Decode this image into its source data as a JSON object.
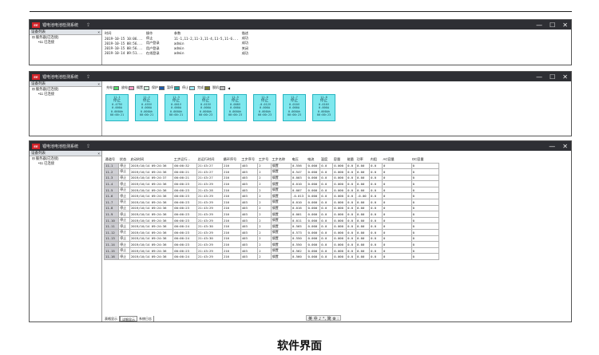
{
  "app": {
    "logo_text": "EE",
    "title": "锂电池电池检测系统",
    "pin_icon": "pin-icon",
    "min": "—",
    "max": "☐",
    "close": "✕"
  },
  "sidebar": {
    "header": "设备列表",
    "close_label": "×",
    "root": "⊟ 服务器(已连接)",
    "child": "•11 已连接"
  },
  "win1": {
    "headers": [
      "时间",
      "操作",
      "参数",
      "描述"
    ],
    "rows": [
      [
        "2019-10-15 10:06...",
        "停止",
        "11-1,11-2,11-3,11-4,11-5,11-6...",
        "成功"
      ],
      [
        "2019-10-15 08:56...",
        "用户登录",
        "admin",
        "成功"
      ],
      [
        "2019-10-15 08:56...",
        "用户登录",
        "admin",
        "关闭"
      ],
      [
        "2019-10-14 09:51...",
        "在线登录",
        "admin",
        "成功"
      ]
    ]
  },
  "win2": {
    "legend": [
      {
        "label": "充电",
        "color": "#53d96a"
      },
      {
        "label": "放电",
        "color": "#f49ac2"
      },
      {
        "label": "搁置",
        "color": "#cfeedd"
      },
      {
        "label": "保护",
        "color": "#1e5aa8"
      },
      {
        "label": "暂停",
        "color": "#2aa6a6"
      },
      {
        "label": "停止",
        "color": "#9fe8f3"
      },
      {
        "label": "完成",
        "color": "#7a7a30"
      },
      {
        "label": "脱机",
        "color": "#bdbdbd"
      }
    ],
    "legend_arrow": "◀",
    "cards": [
      {
        "id": "11-1",
        "state": "停止",
        "v": "0.479V",
        "a": "0.000A",
        "ah": "0.000Ah",
        "t": "00:00:21"
      },
      {
        "id": "11-2",
        "state": "停止",
        "v": "0.455V",
        "a": "0.000A",
        "ah": "0.000Ah",
        "t": "00:00:21"
      },
      {
        "id": "11-3",
        "state": "停止",
        "v": "0.001V",
        "a": "0.000A",
        "ah": "0.000Ah",
        "t": "00:00:21"
      },
      {
        "id": "11-4",
        "state": "停止",
        "v": "0.015V",
        "a": "0.000A",
        "ah": "0.000Ah",
        "t": "00:00:23"
      },
      {
        "id": "11-5",
        "state": "停止",
        "v": "0.008V",
        "a": "0.000A",
        "ah": "0.000Ah",
        "t": "00:00:23"
      },
      {
        "id": "11-6",
        "state": "停止",
        "v": "-0.012V",
        "a": "0.000A",
        "ah": "0.000Ah",
        "t": "00:00:23"
      },
      {
        "id": "11-7",
        "state": "停止",
        "v": "0.010V",
        "a": "0.000A",
        "ah": "0.000Ah",
        "t": "00:00:23"
      },
      {
        "id": "11-8",
        "state": "停止",
        "v": "0.016V",
        "a": "0.000A",
        "ah": "0.000Ah",
        "t": "00:00:23"
      }
    ]
  },
  "win3": {
    "headers": [
      "通道号",
      "状态",
      "启动时间",
      "工步运行...",
      "总运行时间",
      "循环序号",
      "工步序号",
      "工步号",
      "工步名称",
      "电压",
      "电流",
      "温度",
      "容量",
      "能量",
      "功率",
      "内阻",
      "AC容量",
      "DC容量"
    ],
    "rows": [
      [
        "11-1",
        "停止",
        "2019/10/14 09:24:36",
        "00:00:32",
        "21:43:27",
        "216",
        "403",
        "2",
        "搁置",
        "0.556",
        "0.000",
        "0.0",
        "0.000",
        "0.0",
        "0.00",
        "0.0",
        "0",
        "0"
      ],
      [
        "11-2",
        "停止",
        "2019/10/14 09:24:36",
        "00:00:21",
        "21:43:27",
        "216",
        "403",
        "2",
        "搁置",
        "0.547",
        "0.000",
        "0.0",
        "0.000",
        "0.0",
        "0.00",
        "0.0",
        "0",
        "0"
      ],
      [
        "11-3",
        "停止",
        "2019/10/14 09:24:37",
        "00:00:21",
        "21:43:27",
        "216",
        "403",
        "2",
        "搁置",
        "0.003",
        "0.000",
        "0.0",
        "0.000",
        "0.0",
        "0.00",
        "0.0",
        "0",
        "0"
      ],
      [
        "11-4",
        "停止",
        "2019/10/14 09:24:36",
        "00:00:23",
        "21:43:29",
        "216",
        "403",
        "2",
        "搁置",
        "0.010",
        "0.000",
        "0.0",
        "0.000",
        "0.0",
        "0.00",
        "0.0",
        "0",
        "0"
      ],
      [
        "11-5",
        "停止",
        "2019/10/14 09:24:36",
        "00:00:23",
        "21:43:28",
        "216",
        "403",
        "2",
        "搁置",
        "0.007",
        "0.000",
        "0.0",
        "0.000",
        "0.0",
        "0.00",
        "0.0",
        "0",
        "0"
      ],
      [
        "11-6",
        "停止",
        "2019/10/14 09:24:36",
        "00:00:23",
        "21:43:29",
        "216",
        "403",
        "2",
        "搁置",
        "-0.013",
        "0.000",
        "0.0",
        "0.000",
        "0.0",
        "-0.00",
        "0.0",
        "0",
        "0"
      ],
      [
        "11-7",
        "停止",
        "2019/10/14 09:24:36",
        "00:00:23",
        "21:43:29",
        "216",
        "403",
        "2",
        "搁置",
        "0.010",
        "0.000",
        "0.0",
        "0.000",
        "0.0",
        "0.00",
        "0.0",
        "0",
        "0"
      ],
      [
        "11-8",
        "停止",
        "2019/10/14 09:24:36",
        "00:00:23",
        "21:43:29",
        "216",
        "403",
        "2",
        "搁置",
        "0.016",
        "0.000",
        "0.0",
        "0.000",
        "0.0",
        "0.00",
        "0.0",
        "0",
        "0"
      ],
      [
        "11-9",
        "停止",
        "2019/10/14 09:24:36",
        "00:00:23",
        "21:43:29",
        "216",
        "403",
        "2",
        "搁置",
        "0.001",
        "0.000",
        "0.0",
        "0.000",
        "0.0",
        "0.00",
        "0.0",
        "0",
        "0"
      ],
      [
        "11-10",
        "停止",
        "2019/10/14 09:24:36",
        "00:00:23",
        "21:43:29",
        "216",
        "403",
        "2",
        "搁置",
        "0.011",
        "0.000",
        "0.0",
        "0.000",
        "0.0",
        "0.00",
        "0.0",
        "0",
        "0"
      ],
      [
        "11-11",
        "停止",
        "2019/10/14 09:24:36",
        "00:00:24",
        "21:43:30",
        "216",
        "403",
        "2",
        "搁置",
        "0.565",
        "0.000",
        "0.0",
        "0.000",
        "0.0",
        "0.00",
        "0.0",
        "0",
        "0"
      ],
      [
        "11-12",
        "停止",
        "2019/10/14 09:24:36",
        "00:00:23",
        "21:43:29",
        "216",
        "403",
        "2",
        "搁置",
        "0.573",
        "0.000",
        "0.0",
        "0.000",
        "0.0",
        "0.00",
        "0.0",
        "0",
        "0"
      ],
      [
        "11-13",
        "停止",
        "2019/10/14 09:24:36",
        "00:00:24",
        "21:43:30",
        "216",
        "403",
        "2",
        "搁置",
        "0.550",
        "0.000",
        "0.0",
        "0.000",
        "0.0",
        "0.00",
        "0.0",
        "0",
        "0"
      ],
      [
        "11-14",
        "停止",
        "2019/10/14 09:24:36",
        "00:00:23",
        "21:43:29",
        "216",
        "403",
        "2",
        "搁置",
        "0.550",
        "0.000",
        "0.0",
        "0.000",
        "0.0",
        "0.00",
        "0.0",
        "0",
        "0"
      ],
      [
        "11-15",
        "停止",
        "2019/10/14 09:24:36",
        "00:00:23",
        "21:43:29",
        "216",
        "403",
        "2",
        "搁置",
        "0.562",
        "0.000",
        "0.0",
        "0.000",
        "0.0",
        "0.00",
        "0.0",
        "0",
        "0"
      ],
      [
        "11-16",
        "停止",
        "2019/10/14 09:24:36",
        "00:00:24",
        "21:43:29",
        "216",
        "403",
        "2",
        "搁置",
        "0.560",
        "0.000",
        "0.0",
        "0.000",
        "0.0",
        "0.00",
        "0.0",
        "0",
        "0"
      ]
    ],
    "tabs": [
      "表格显示",
      "详细显示",
      "系统日志"
    ],
    "ime_text": "英 中 ♪ °, 简 ⚙ :"
  },
  "caption": "软件界面"
}
